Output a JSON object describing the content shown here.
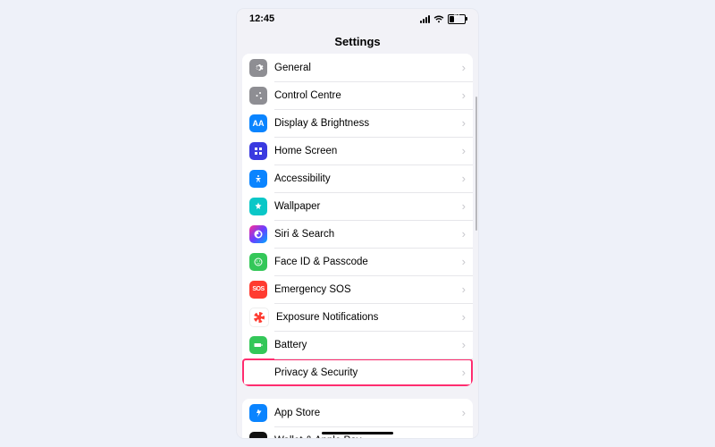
{
  "status": {
    "time": "12:45",
    "battery_pct": 37
  },
  "header": {
    "title": "Settings"
  },
  "highlighted_item": "privacy",
  "groups": [
    {
      "items": [
        {
          "id": "general",
          "label": "General",
          "icon": "gear-icon"
        },
        {
          "id": "control",
          "label": "Control Centre",
          "icon": "sliders-icon"
        },
        {
          "id": "display",
          "label": "Display & Brightness",
          "icon": "textsize-icon"
        },
        {
          "id": "home",
          "label": "Home Screen",
          "icon": "grid-icon"
        },
        {
          "id": "access",
          "label": "Accessibility",
          "icon": "person-icon"
        },
        {
          "id": "wall",
          "label": "Wallpaper",
          "icon": "flower-icon"
        },
        {
          "id": "siri",
          "label": "Siri & Search",
          "icon": "siri-icon"
        },
        {
          "id": "face",
          "label": "Face ID & Passcode",
          "icon": "face-icon"
        },
        {
          "id": "sos",
          "label": "Emergency SOS",
          "icon": "sos-icon"
        },
        {
          "id": "exp",
          "label": "Exposure Notifications",
          "icon": "exposure-icon"
        },
        {
          "id": "batt",
          "label": "Battery",
          "icon": "battery-icon"
        },
        {
          "id": "privacy",
          "label": "Privacy & Security",
          "icon": "hand-icon"
        }
      ]
    },
    {
      "items": [
        {
          "id": "store",
          "label": "App Store",
          "icon": "appstore-icon"
        },
        {
          "id": "wallet",
          "label": "Wallet & Apple Pay",
          "icon": "wallet-icon"
        }
      ]
    }
  ]
}
